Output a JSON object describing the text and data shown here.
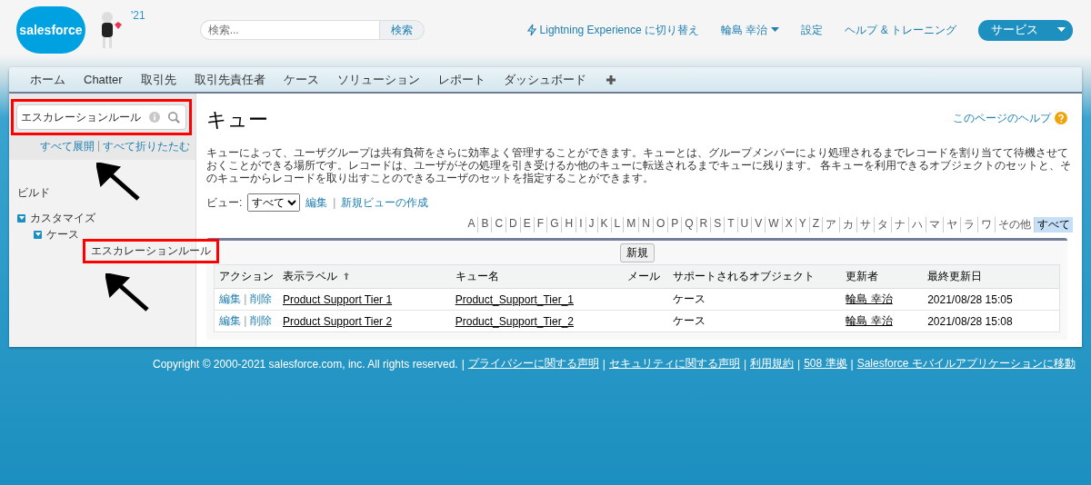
{
  "header": {
    "logo_text": "salesforce",
    "badge": "'21",
    "search": {
      "placeholder": "検索..."
    },
    "search_button": "検索",
    "links": [
      {
        "kind": "lightning",
        "label": "Lightning Experience に切り替え"
      },
      {
        "kind": "user",
        "label": "輪島 幸治"
      },
      {
        "kind": "plain",
        "label": "設定"
      },
      {
        "kind": "plain",
        "label": "ヘルプ & トレーニング"
      }
    ],
    "app_menu": "サービス"
  },
  "tabs": [
    {
      "label": "ホーム",
      "selected": false
    },
    {
      "label": "Chatter",
      "selected": false
    },
    {
      "label": "取引先",
      "selected": false
    },
    {
      "label": "取引先責任者",
      "selected": false
    },
    {
      "label": "ケース",
      "selected": false
    },
    {
      "label": "ソリューション",
      "selected": false
    },
    {
      "label": "レポート",
      "selected": false
    },
    {
      "label": "ダッシュボード",
      "selected": false
    }
  ],
  "sidebar": {
    "search": {
      "value": "エスカレーションルール",
      "highlighted": true
    },
    "expand_all": "すべて展開",
    "link_separator": "|",
    "collapse_all": "すべて折りたたむ",
    "section": "ビルド",
    "tree": [
      {
        "label": "カスタマイズ",
        "expanded": true,
        "children": [
          {
            "label": "ケース",
            "expanded": true,
            "children": [
              {
                "label": "エスカレーションルール",
                "highlighted": true
              }
            ]
          }
        ]
      }
    ]
  },
  "main": {
    "title": "キュー",
    "help_link": "このページのヘルプ",
    "description": "キューによって、ユーザグループは共有負荷をさらに効率よく管理することができます。キューとは、グループメンバーにより処理されるまでレコードを割り当てて待機させておくことができる場所です。レコードは、ユーザがその処理を引き受けるか他のキューに転送されるまでキューに残ります。 各キューを利用できるオブジェクトのセットと、そのキューからレコードを取り出すことのできるユーザのセットを指定することができます。",
    "view_label": "ビュー:",
    "view_select": "すべて",
    "edit_link": "編集",
    "link_separator": "|",
    "new_view_link": "新規ビューの作成",
    "letters": [
      {
        "label": "A",
        "selected": false
      },
      {
        "label": "B",
        "selected": false
      },
      {
        "label": "C",
        "selected": false
      },
      {
        "label": "D",
        "selected": false
      },
      {
        "label": "E",
        "selected": false
      },
      {
        "label": "F",
        "selected": false
      },
      {
        "label": "G",
        "selected": false
      },
      {
        "label": "H",
        "selected": false
      },
      {
        "label": "I",
        "selected": false
      },
      {
        "label": "J",
        "selected": false
      },
      {
        "label": "K",
        "selected": false
      },
      {
        "label": "L",
        "selected": false
      },
      {
        "label": "M",
        "selected": false
      },
      {
        "label": "N",
        "selected": false
      },
      {
        "label": "O",
        "selected": false
      },
      {
        "label": "P",
        "selected": false
      },
      {
        "label": "Q",
        "selected": false
      },
      {
        "label": "R",
        "selected": false
      },
      {
        "label": "S",
        "selected": false
      },
      {
        "label": "T",
        "selected": false
      },
      {
        "label": "U",
        "selected": false
      },
      {
        "label": "V",
        "selected": false
      },
      {
        "label": "W",
        "selected": false
      },
      {
        "label": "X",
        "selected": false
      },
      {
        "label": "Y",
        "selected": false
      },
      {
        "label": "Z",
        "selected": false
      },
      {
        "label": "ア",
        "selected": false
      },
      {
        "label": "カ",
        "selected": false
      },
      {
        "label": "サ",
        "selected": false
      },
      {
        "label": "タ",
        "selected": false
      },
      {
        "label": "ナ",
        "selected": false
      },
      {
        "label": "ハ",
        "selected": false
      },
      {
        "label": "マ",
        "selected": false
      },
      {
        "label": "ヤ",
        "selected": false
      },
      {
        "label": "ラ",
        "selected": false
      },
      {
        "label": "ワ",
        "selected": false
      },
      {
        "label": "その他",
        "selected": false
      },
      {
        "label": "すべて",
        "selected": true
      }
    ],
    "new_button": "新規",
    "table": {
      "columns": [
        {
          "label": "アクション",
          "sorted": false
        },
        {
          "label": "表示ラベル",
          "sorted": true
        },
        {
          "label": "キュー名",
          "sorted": false
        },
        {
          "label": "メール",
          "sorted": false
        },
        {
          "label": "サポートされるオブジェクト",
          "sorted": false
        },
        {
          "label": "更新者",
          "sorted": false
        },
        {
          "label": "最終更新日",
          "sorted": false
        }
      ],
      "rows": [
        {
          "edit": "編集",
          "separator": "|",
          "delete": "削除",
          "label": "Product Support Tier 1",
          "queue_name": "Product_Support_Tier_1",
          "object": "ケース",
          "modified_by": "輪島 幸治",
          "modified_date": "2021/08/28 15:05"
        },
        {
          "edit": "編集",
          "separator": "|",
          "delete": "削除",
          "label": "Product Support Tier 2",
          "queue_name": "Product_Support_Tier_2",
          "object": "ケース",
          "modified_by": "輪島 幸治",
          "modified_date": "2021/08/28 15:08"
        }
      ]
    }
  },
  "footer": {
    "separators": [
      "|",
      "|",
      "|",
      "|",
      "|"
    ],
    "copyright": "Copyright © 2000-2021 salesforce.com, inc. All rights reserved.",
    "links": [
      "プライバシーに関する声明",
      "セキュリティに関する声明",
      "利用規約",
      "508 準拠",
      "Salesforce モバイルアプリケーションに移動"
    ]
  }
}
